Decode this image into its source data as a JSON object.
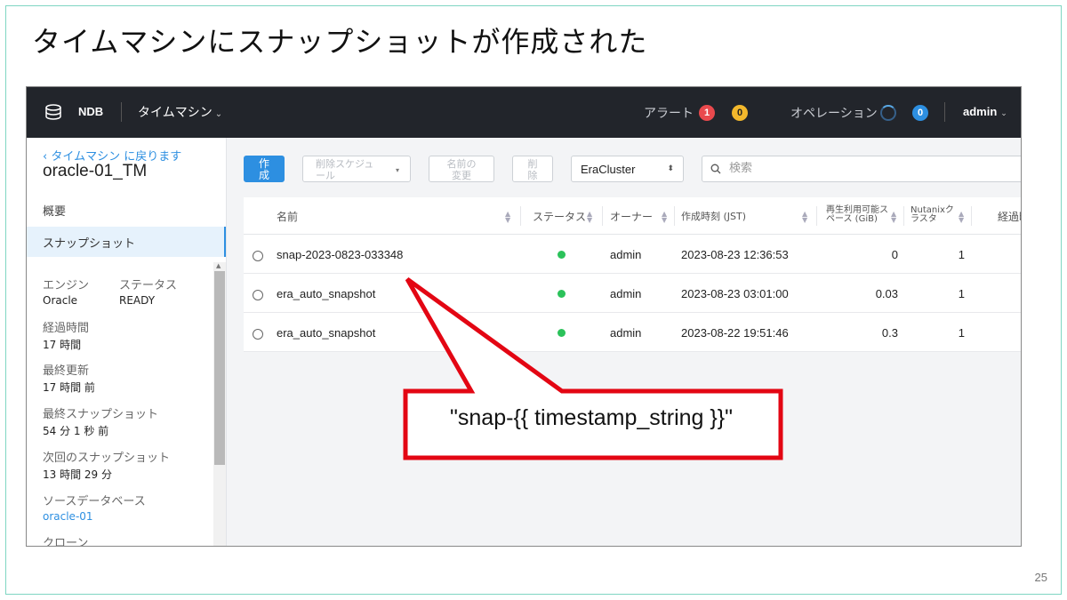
{
  "slide": {
    "title": "タイムマシンにスナップショットが作成された",
    "page_number": "25"
  },
  "topbar": {
    "brand": "NDB",
    "nav_label": "タイムマシン",
    "alerts_label": "アラート",
    "alerts_critical_count": "1",
    "alerts_warning_count": "0",
    "operations_label": "オペレーション",
    "operations_count": "0",
    "user": "admin"
  },
  "sidebar": {
    "back_link": "‹ タイムマシン に戻ります",
    "entity_title": "oracle-01_TM",
    "nav_overview": "概要",
    "nav_snapshots": "スナップショット",
    "engine_label": "エンジン",
    "engine_value": "Oracle",
    "status_label": "ステータス",
    "status_value": "READY",
    "elapsed_label": "経過時間",
    "elapsed_value": "17 時間",
    "last_updated_label": "最終更新",
    "last_updated_value": "17 時間 前",
    "last_snapshot_label": "最終スナップショット",
    "last_snapshot_value": "54 分 1 秒 前",
    "next_snapshot_label": "次回のスナップショット",
    "next_snapshot_value": "13 時間 29 分",
    "source_db_label": "ソースデータベース",
    "source_db_value": "oracle-01",
    "clones_label": "クローン"
  },
  "toolbar": {
    "create_label": "作成",
    "delete_schedule_label": "削除スケジュール",
    "rename_label": "名前の変更",
    "delete_label": "削除",
    "cluster_value": "EraCluster",
    "search_placeholder": "検索"
  },
  "table": {
    "columns": {
      "name": "名前",
      "status": "ステータス",
      "owner": "オーナー",
      "created": "作成時刻 (JST)",
      "reclaimable": "再生利用可能スペース (GiB)",
      "nutanix_cluster": "Nutanixクラスタ",
      "elapsed": "経過時"
    },
    "rows": [
      {
        "name": "snap-2023-0823-033348",
        "owner": "admin",
        "created": "2023-08-23 12:36:53",
        "reclaimable": "0",
        "clusters": "1"
      },
      {
        "name": "era_auto_snapshot",
        "owner": "admin",
        "created": "2023-08-23 03:01:00",
        "reclaimable": "0.03",
        "clusters": "1"
      },
      {
        "name": "era_auto_snapshot",
        "owner": "admin",
        "created": "2023-08-22 19:51:46",
        "reclaimable": "0.3",
        "clusters": "1"
      }
    ]
  },
  "callout": {
    "text": "\"snap-{{ timestamp_string }}\"",
    "color": "#e30613"
  },
  "colors": {
    "accent": "#2d8fe1",
    "status_ok": "#2bc25a",
    "frame": "#7fd6c2"
  }
}
